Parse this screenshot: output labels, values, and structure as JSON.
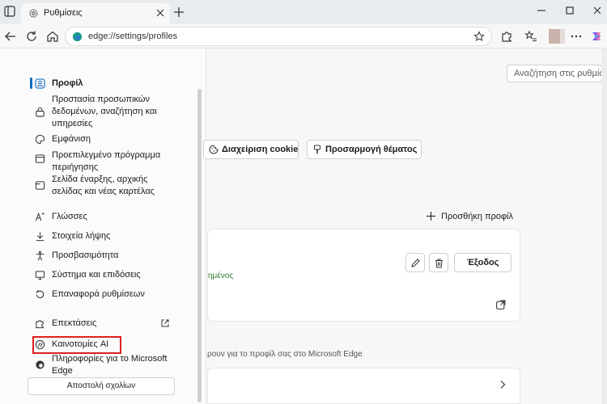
{
  "browser": {
    "tab_title": "Ρυθμίσεις",
    "url": "edge://settings/profiles"
  },
  "sidebar": {
    "items": [
      {
        "label": "Προφίλ",
        "icon": "profile-icon",
        "selected": true
      },
      {
        "label": "Προστασία προσωπικών\nδεδομένων, αναζήτηση και\nυπηρεσίες",
        "icon": "lock-icon"
      },
      {
        "label": "Εμφάνιση",
        "icon": "appearance-icon"
      },
      {
        "label": "Προεπιλεγμένο πρόγραμμα\nπεριήγησης",
        "icon": "browser-icon"
      },
      {
        "label": "Σελίδα έναρξης, αρχικής\nσελίδας και νέας καρτέλας",
        "icon": "newtab-icon"
      },
      {
        "label": "Γλώσσες",
        "icon": "languages-icon"
      },
      {
        "label": "Στοιχεία λήψης",
        "icon": "download-icon"
      },
      {
        "label": "Προσβασιμότητα",
        "icon": "accessibility-icon"
      },
      {
        "label": "Σύστημα και επιδόσεις",
        "icon": "system-icon"
      },
      {
        "label": "Επαναφορά ρυθμίσεων",
        "icon": "reset-icon"
      },
      {
        "label": "Επεκτάσεις",
        "icon": "extensions-icon"
      },
      {
        "label": "Καινοτομίες AI",
        "icon": "ai-icon"
      },
      {
        "label": "Πληροφορίες για το Microsoft\nEdge",
        "icon": "edge-icon"
      }
    ],
    "feedback_label": "Αποστολή σχολίων"
  },
  "main": {
    "search_placeholder": "Αναζήτηση στις ρυθμίσεις",
    "cookie_button": "Διαχείριση cookie",
    "theme_button": "Προσαρμογή θέματος",
    "add_profile": "Προσθήκη προφίλ",
    "sync_status": "ημένος",
    "signout_button": "Έξοδος",
    "info_text": "ρουν για το προφίλ σας στο Microsoft Edge"
  },
  "colors": {
    "accent": "#0f6cbd",
    "highlight": "#e02020",
    "sync_green": "#2f7d32"
  }
}
